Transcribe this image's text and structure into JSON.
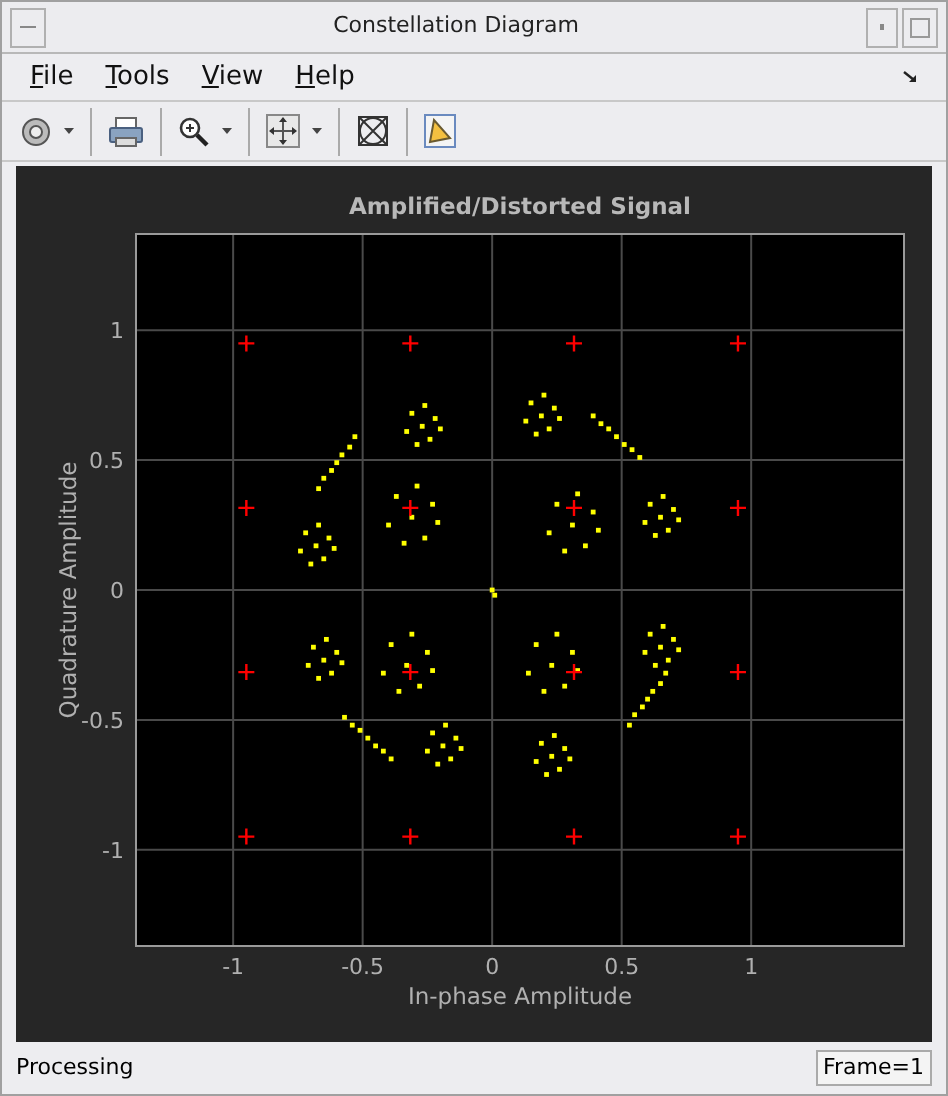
{
  "window": {
    "title": "Constellation Diagram"
  },
  "menu": [
    {
      "label": "File"
    },
    {
      "label": "Tools"
    },
    {
      "label": "View"
    },
    {
      "label": "Help"
    }
  ],
  "plot": {
    "chart_data": {
      "type": "scatter",
      "title": "Amplified/Distorted Signal",
      "xlabel": "In-phase Amplitude",
      "ylabel": "Quadrature Amplitude",
      "xlim": [
        -1.375,
        1.59
      ],
      "ylim": [
        -1.37,
        1.37
      ],
      "xticks": [
        -1,
        -0.5,
        0,
        0.5,
        1
      ],
      "yticks": [
        -1,
        -0.5,
        0,
        0.5,
        1
      ],
      "grid": true,
      "series": [
        {
          "color": "#ffff00",
          "x": [
            -0.27,
            -0.22,
            -0.31,
            -0.24,
            -0.33,
            -0.2,
            -0.29,
            -0.26,
            0.19,
            0.24,
            0.15,
            0.22,
            0.13,
            0.26,
            0.17,
            0.2,
            0.39,
            0.42,
            0.45,
            0.48,
            0.51,
            0.54,
            0.57,
            0.65,
            0.7,
            0.61,
            0.68,
            0.59,
            0.72,
            0.63,
            0.66,
            0.65,
            0.7,
            0.61,
            0.68,
            0.59,
            0.72,
            0.63,
            0.66,
            0.53,
            0.55,
            0.58,
            0.6,
            0.62,
            0.65,
            0.67,
            0.23,
            0.28,
            0.19,
            0.26,
            0.17,
            0.3,
            0.21,
            0.24,
            -0.19,
            -0.14,
            -0.23,
            -0.16,
            -0.25,
            -0.12,
            -0.21,
            -0.18,
            -0.57,
            -0.54,
            -0.51,
            -0.48,
            -0.45,
            -0.42,
            -0.39,
            -0.65,
            -0.6,
            -0.69,
            -0.62,
            -0.71,
            -0.58,
            -0.67,
            -0.64,
            -0.68,
            -0.63,
            -0.72,
            -0.65,
            -0.74,
            -0.61,
            -0.7,
            -0.67,
            -0.67,
            -0.65,
            -0.62,
            -0.6,
            -0.58,
            -0.55,
            -0.53,
            -0.31,
            -0.23,
            -0.37,
            -0.26,
            -0.4,
            -0.21,
            -0.34,
            -0.29,
            0.31,
            0.39,
            0.25,
            0.36,
            0.22,
            0.41,
            0.28,
            0.33,
            -0.33,
            -0.25,
            -0.39,
            -0.28,
            -0.42,
            -0.23,
            -0.36,
            -0.31,
            0.23,
            0.31,
            0.17,
            0.28,
            0.14,
            0.33,
            0.2,
            0.25,
            0.0,
            0.01
          ],
          "values": [
            0.63,
            0.66,
            0.68,
            0.58,
            0.61,
            0.62,
            0.56,
            0.71,
            0.67,
            0.7,
            0.72,
            0.62,
            0.65,
            0.66,
            0.6,
            0.75,
            0.67,
            0.64,
            0.62,
            0.59,
            0.56,
            0.54,
            0.51,
            0.28,
            0.31,
            0.33,
            0.23,
            0.26,
            0.27,
            0.21,
            0.36,
            -0.22,
            -0.19,
            -0.17,
            -0.27,
            -0.24,
            -0.23,
            -0.29,
            -0.14,
            -0.52,
            -0.48,
            -0.45,
            -0.42,
            -0.39,
            -0.36,
            -0.32,
            -0.64,
            -0.61,
            -0.59,
            -0.69,
            -0.66,
            -0.65,
            -0.71,
            -0.56,
            -0.6,
            -0.57,
            -0.55,
            -0.65,
            -0.62,
            -0.61,
            -0.67,
            -0.52,
            -0.49,
            -0.52,
            -0.54,
            -0.57,
            -0.6,
            -0.62,
            -0.65,
            -0.27,
            -0.24,
            -0.22,
            -0.32,
            -0.29,
            -0.28,
            -0.34,
            -0.19,
            0.17,
            0.2,
            0.22,
            0.12,
            0.15,
            0.16,
            0.1,
            0.25,
            0.39,
            0.43,
            0.46,
            0.49,
            0.52,
            0.55,
            0.59,
            0.28,
            0.33,
            0.36,
            0.2,
            0.25,
            0.26,
            0.18,
            0.4,
            0.25,
            0.3,
            0.33,
            0.17,
            0.22,
            0.23,
            0.15,
            0.37,
            -0.29,
            -0.24,
            -0.21,
            -0.37,
            -0.32,
            -0.31,
            -0.39,
            -0.17,
            -0.29,
            -0.24,
            -0.21,
            -0.37,
            -0.32,
            -0.31,
            -0.39,
            -0.17,
            0.0,
            -0.02
          ]
        },
        {
          "color": "#ff0000",
          "x": [
            -0.949,
            -0.316,
            0.316,
            0.949,
            -0.949,
            -0.316,
            0.316,
            0.949,
            -0.949,
            -0.316,
            0.316,
            0.949,
            -0.949,
            -0.316,
            0.316,
            0.949
          ],
          "values": [
            0.949,
            0.949,
            0.949,
            0.949,
            0.316,
            0.316,
            0.316,
            0.316,
            -0.316,
            -0.316,
            -0.316,
            -0.316,
            -0.949,
            -0.949,
            -0.949,
            -0.949
          ]
        }
      ]
    }
  },
  "status_bar": {
    "message": "Processing",
    "frame": "Frame=1"
  }
}
